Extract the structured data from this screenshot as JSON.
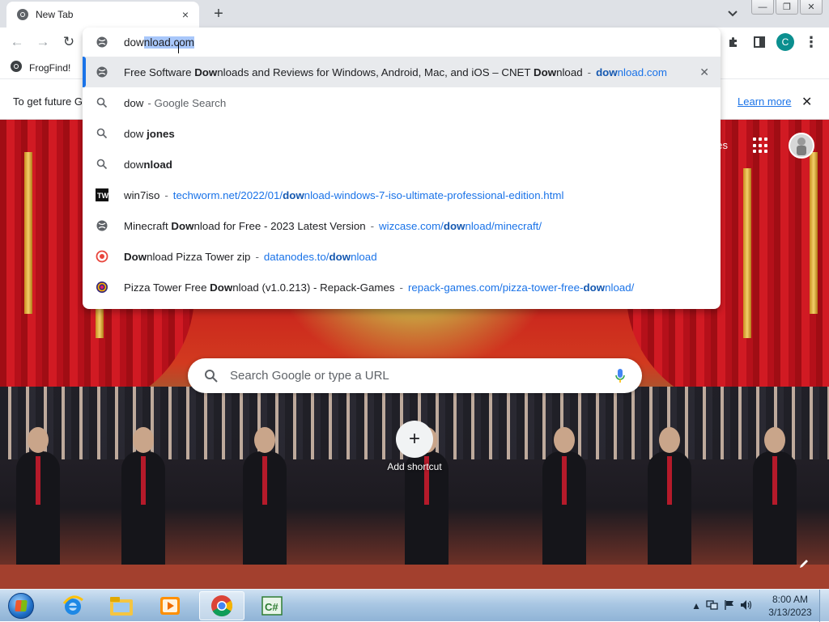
{
  "tab": {
    "title": "New Tab",
    "close": "×"
  },
  "newtab": "+",
  "window_controls": {
    "minimize": "—",
    "maximize": "❐",
    "close": "✕"
  },
  "toolbar": {
    "back": "←",
    "forward": "→",
    "reload": "↻",
    "profile_initial": "C",
    "menu": "⋮"
  },
  "omnibox": {
    "typed_plain": "dow",
    "typed_selected": "nload.com",
    "suggestions": [
      {
        "icon": "globe-icon",
        "pre": "Free Software ",
        "bold": "Dow",
        "post": "nloads and Reviews for Windows, Android, Mac, and iOS – CNET ",
        "bold2": "Dow",
        "post2": "nload",
        "sep": "-",
        "url_pre": "",
        "url_bold": "dow",
        "url_post": "nload.com",
        "remove": "✕"
      },
      {
        "icon": "search-icon",
        "text_plain": "dow",
        "text_gray": "- Google Search"
      },
      {
        "icon": "search-icon",
        "text_plain": "dow ",
        "text_bold": "jones"
      },
      {
        "icon": "search-icon",
        "text_plain": "dow",
        "text_bold": "nload"
      },
      {
        "icon": "techworm-icon",
        "main": "win7iso",
        "sep": "-",
        "url_pre": "techworm.net/2022/01/",
        "url_bold": "dow",
        "url_post": "nload-windows-7-iso-ultimate-professional-edition.html"
      },
      {
        "icon": "globe-icon",
        "pre": "Minecraft ",
        "bold": "Dow",
        "post": "nload for Free - 2023 Latest Version",
        "sep": "-",
        "url_pre": "wizcase.com/",
        "url_bold": "dow",
        "url_post": "nload/minecraft/"
      },
      {
        "icon": "datanodes-icon",
        "pre": "",
        "bold": "Dow",
        "post": "nload Pizza Tower zip",
        "sep": "-",
        "url_pre": "datanodes.to/",
        "url_bold": "dow",
        "url_post": "nload"
      },
      {
        "icon": "repack-games-icon",
        "pre": "Pizza Tower Free ",
        "bold": "Dow",
        "post": "nload (v1.0.213) - Repack-Games",
        "sep": "-",
        "url_pre": "repack-games.com/pizza-tower-free-",
        "url_bold": "dow",
        "url_post": "nload/"
      }
    ]
  },
  "bookmarks": [
    {
      "label": "FrogFind!"
    }
  ],
  "infobar": {
    "text": "To get future G",
    "learn_more": "Learn more",
    "close": "✕"
  },
  "ntp": {
    "images_link": "ges",
    "search_placeholder": "Search Google or type a URL",
    "add_shortcut_label": "Add shortcut",
    "add_symbol": "+"
  },
  "taskbar": {
    "items": [
      "internet-explorer",
      "file-explorer",
      "media-player",
      "chrome",
      "csharp-app"
    ],
    "time": "8:00 AM",
    "date": "3/13/2023"
  }
}
